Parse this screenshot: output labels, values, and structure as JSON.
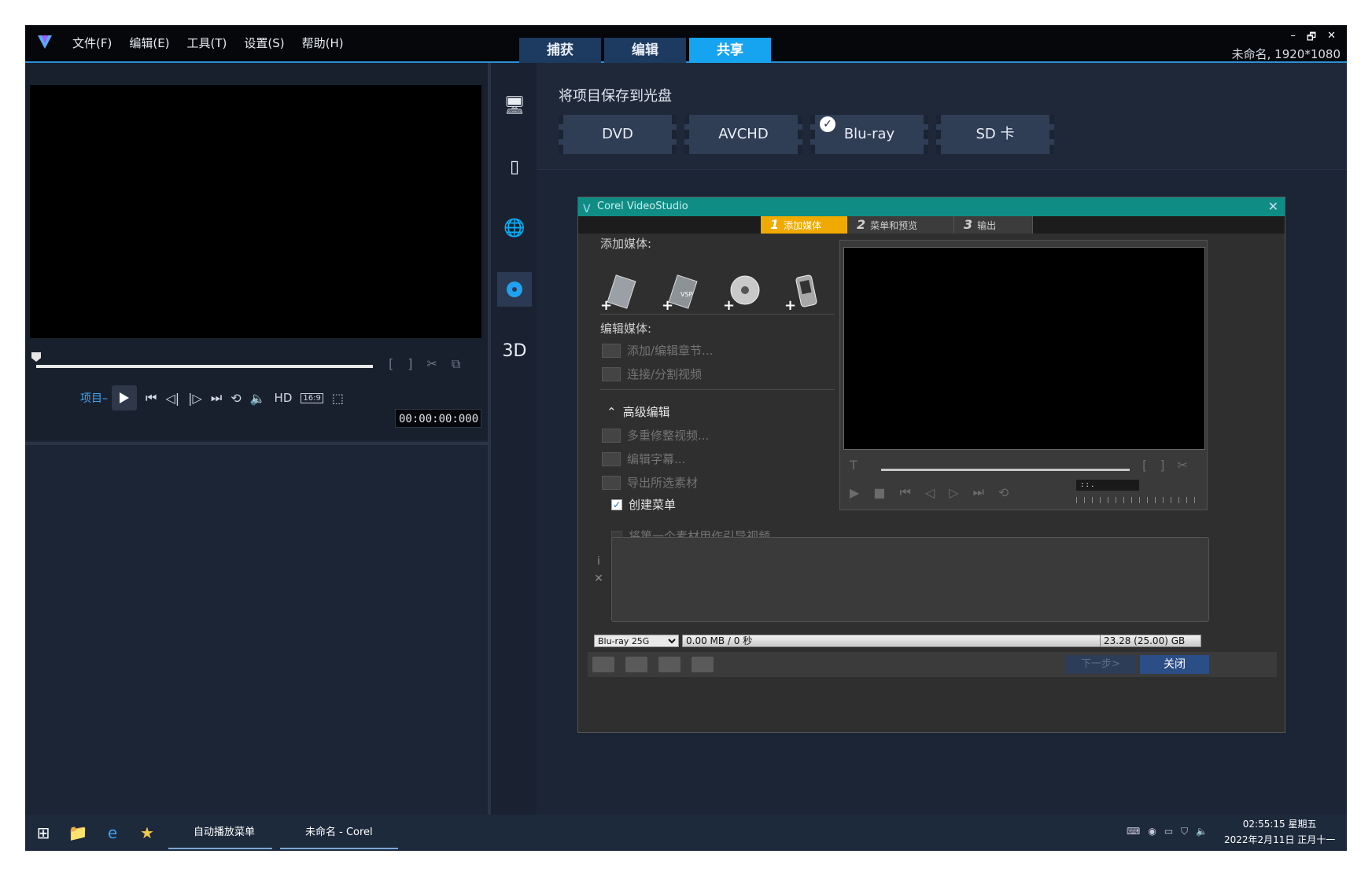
{
  "app": {
    "menu": [
      "文件(F)",
      "编辑(E)",
      "工具(T)",
      "设置(S)",
      "帮助(H)"
    ],
    "tabs": [
      "捕获",
      "编辑",
      "共享"
    ],
    "window_controls": [
      "–",
      "🗗",
      "✕"
    ],
    "project_info": "未命名, 1920*1080",
    "accent": "#16a3f0"
  },
  "player": {
    "project_label": "项目–",
    "hd_label": "HD",
    "ratio_label": "16:9",
    "timecode": "00:00:00:000"
  },
  "share": {
    "title": "将项目保存到光盘",
    "disc_options": [
      "DVD",
      "AVCHD",
      "Blu-ray",
      "SD 卡"
    ],
    "selected": "Blu-ray"
  },
  "dialog": {
    "title": "Corel VideoStudio",
    "close": "✕",
    "steps": [
      {
        "num": "1",
        "label": "添加媒体"
      },
      {
        "num": "2",
        "label": "菜单和预览"
      },
      {
        "num": "3",
        "label": "输出"
      }
    ],
    "add_media_label": "添加媒体:",
    "edit_media_label": "编辑媒体:",
    "edit_options": [
      "添加/编辑章节...",
      "连接/分割视频"
    ],
    "advanced_label": "高级编辑",
    "advanced_options": [
      "多重修整视频...",
      "编辑字幕...",
      "导出所选素材"
    ],
    "create_menu_label": "创建菜单",
    "intro_video_label": "将第一个素材用作引导视频",
    "preview_time": ":  :  .",
    "disc_type": "Blu-ray 25G",
    "capacity_used": "0.00 MB / 0 秒",
    "capacity_total": "23.28 (25.00) GB",
    "next_button": "下一步>",
    "close_button": "关闭",
    "info_icon": "i",
    "remove_icon": "✕"
  },
  "taskbar": {
    "task1": "自动播放菜单",
    "task2": "未命名 - Corel Vid...",
    "time": "02:55:15 星期五",
    "date": "2022年2月11日 正月十一"
  }
}
